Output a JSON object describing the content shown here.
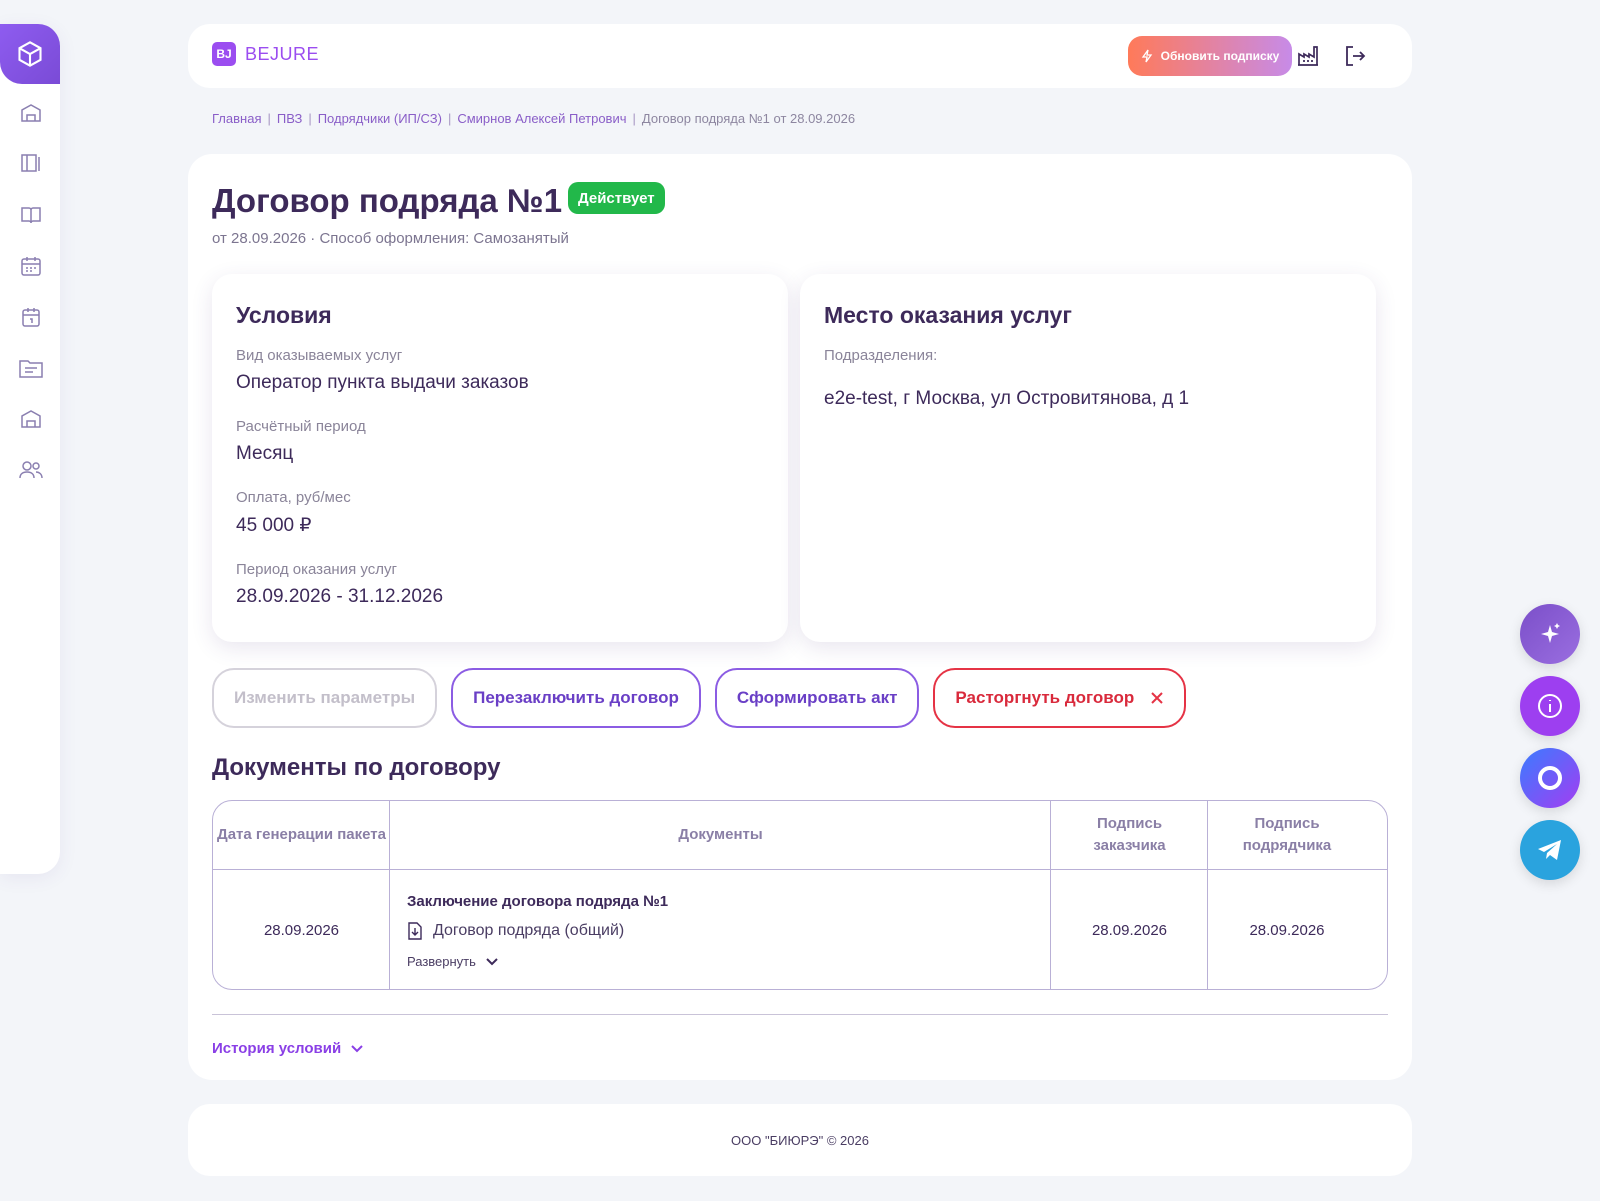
{
  "brand": {
    "mark": "BJ",
    "name": "BEJURE"
  },
  "header": {
    "upgrade_label": "Обновить подписку"
  },
  "breadcrumb": [
    "Главная",
    "ПВЗ",
    "Подрядчики (ИП/СЗ)",
    "Смирнов Алексей Петрович",
    "Договор подряда №1 от 28.09.2026"
  ],
  "contract": {
    "title": "Договор подряда №1",
    "status": "Действует",
    "subtitle": "от 28.09.2026 · Способ оформления: Самозанятый"
  },
  "conditions": {
    "heading": "Условия",
    "fields": [
      {
        "label": "Вид оказываемых услуг",
        "value": "Оператор пункта выдачи заказов"
      },
      {
        "label": "Расчётный период",
        "value": "Месяц"
      },
      {
        "label": "Оплата, руб/мес",
        "value": "45 000 ₽"
      },
      {
        "label": "Период оказания услуг",
        "value": "28.09.2026 - 31.12.2026"
      }
    ]
  },
  "location": {
    "heading": "Место оказания услуг",
    "label": "Подразделения:",
    "value": "e2e-test, г Москва, ул Островитянова, д 1"
  },
  "actions": {
    "edit": "Изменить параметры",
    "renew": "Перезаключить договор",
    "act": "Сформировать акт",
    "terminate": "Расторгнуть договор"
  },
  "documents": {
    "heading": "Документы по договору",
    "columns": [
      "Дата генерации пакета",
      "Документы",
      "Подпись заказчика",
      "Подпись подрядчика"
    ],
    "rows": [
      {
        "date": "28.09.2026",
        "package_title": "Заключение договора подряда №1",
        "file": "Договор подряда (общий)",
        "expand": "Развернуть",
        "customer_sign": "28.09.2026",
        "contractor_sign": "28.09.2026"
      }
    ]
  },
  "history_label": "История условий",
  "footer": "ООО \"БИЮРЭ\" © 2026",
  "colors": {
    "accent": "#8b5ce3",
    "status": "#22b84a",
    "danger": "#e53345"
  }
}
